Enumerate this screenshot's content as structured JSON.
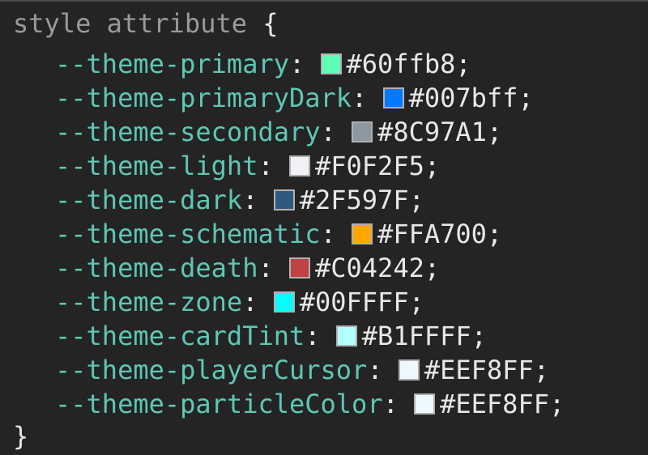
{
  "header": {
    "selector": "style attribute",
    "open_brace": "{"
  },
  "closing_brace": "}",
  "properties": [
    {
      "name": "--theme-primary",
      "value": "#60ffb8",
      "color": "#60ffb8"
    },
    {
      "name": "--theme-primaryDark",
      "value": "#007bff",
      "color": "#007bff"
    },
    {
      "name": "--theme-secondary",
      "value": "#8C97A1",
      "color": "#8C97A1"
    },
    {
      "name": "--theme-light",
      "value": "#F0F2F5",
      "color": "#F0F2F5"
    },
    {
      "name": "--theme-dark",
      "value": "#2F597F",
      "color": "#2F597F"
    },
    {
      "name": "--theme-schematic",
      "value": "#FFA700",
      "color": "#FFA700"
    },
    {
      "name": "--theme-death",
      "value": "#C04242",
      "color": "#C04242"
    },
    {
      "name": "--theme-zone",
      "value": "#00FFFF",
      "color": "#00FFFF"
    },
    {
      "name": "--theme-cardTint",
      "value": "#B1FFFF",
      "color": "#B1FFFF"
    },
    {
      "name": "--theme-playerCursor",
      "value": "#EEF8FF",
      "color": "#EEF8FF"
    },
    {
      "name": "--theme-particleColor",
      "value": "#EEF8FF",
      "color": "#EEF8FF"
    }
  ]
}
